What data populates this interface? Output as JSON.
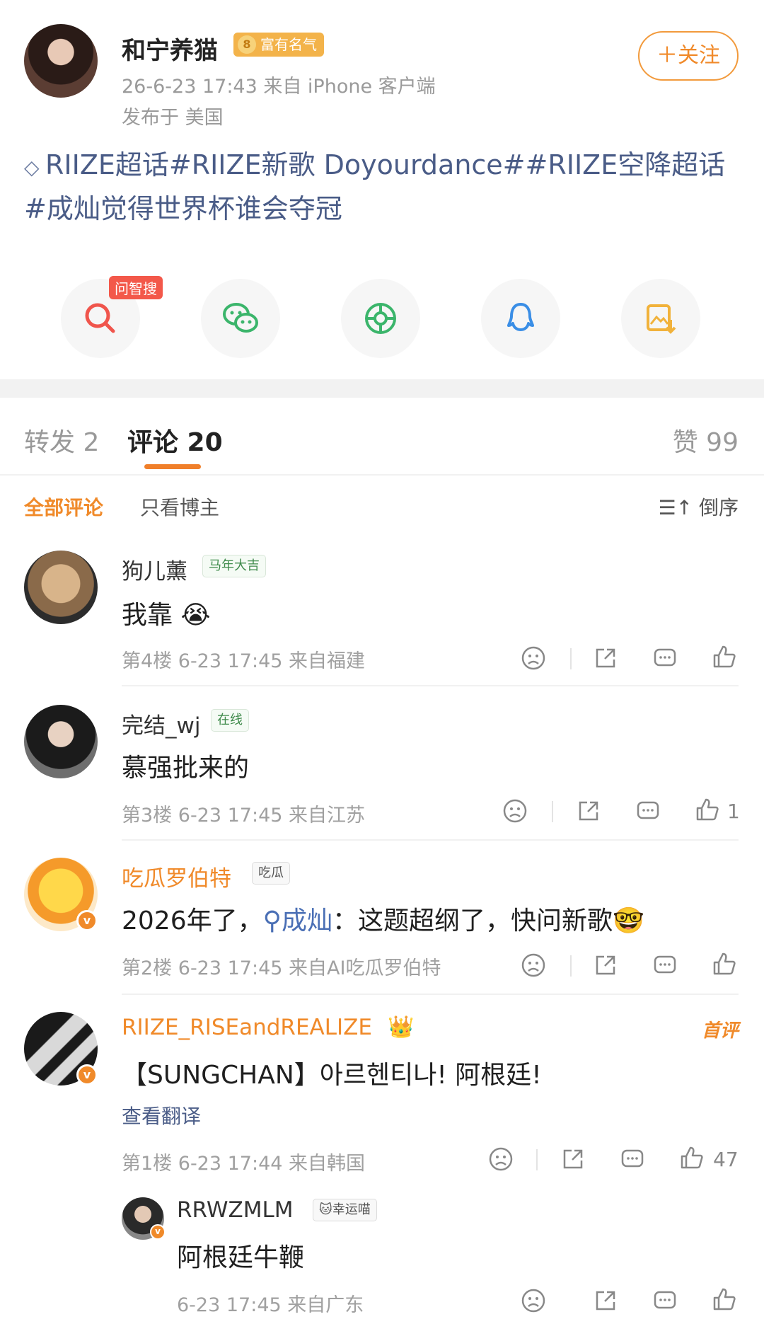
{
  "post": {
    "author": "和宁养猫",
    "fame_badge": "富有名气",
    "fame_level": "8",
    "time_source": "26-6-23 17:43  来自 iPhone 客户端",
    "location": "发布于 美国",
    "follow_label": "＋关注",
    "body": "RIIZE超话#RIIZE新歌 Doyourdance##RIIZE空降超话#成灿觉得世界杯谁会夺冠",
    "zhisou_tag": "问智搜"
  },
  "share_icons": [
    "zhisou-search-icon",
    "wechat-icon",
    "moments-icon",
    "qq-icon",
    "save-image-icon"
  ],
  "tabs": {
    "repost": "转发 2",
    "comments": "评论 20",
    "likes": "赞 99"
  },
  "filters": {
    "all": "全部评论",
    "owner_only": "只看博主",
    "sort": "倒序"
  },
  "comments": [
    {
      "name": "狗儿薰",
      "badge": "马年大吉",
      "text": "我靠",
      "meta": "第4楼 6-23 17:45 来自福建",
      "likes": ""
    },
    {
      "name": "完结_wj",
      "badge": "在线",
      "text": "慕强批来的",
      "meta": "第3楼 6-23 17:45 来自江苏",
      "likes": "1"
    },
    {
      "name": "吃瓜罗伯特",
      "badge": "吃瓜",
      "text_prefix": "2026年了，",
      "text_link": "成灿",
      "text_suffix": "：这题超纲了，快问新歌",
      "meta": "第2楼 6-23 17:45 来自AI吃瓜罗伯特",
      "likes": ""
    },
    {
      "name": "RIIZE_RISEandREALIZE",
      "first_tag": "首评",
      "text": "【SUNGCHAN】아르헨티나! 阿根廷!",
      "translate": "查看翻译",
      "meta": "第1楼 6-23 17:44 来自韩国",
      "likes": "47"
    }
  ],
  "reply": {
    "name": "RRWZMLM",
    "badge": "幸运喵",
    "text": "阿根廷牛鞭",
    "meta": "6-23 17:45 来自广东"
  },
  "colors": {
    "accent": "#f08a2a",
    "link": "#4a5c87",
    "muted": "#9a9a9a"
  }
}
